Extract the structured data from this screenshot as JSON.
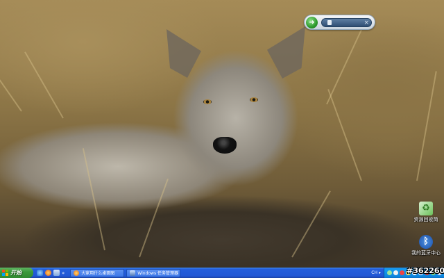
{
  "desktop": {
    "wallpaper": "wolf-in-grass",
    "icons": [
      {
        "label": "资源回收筒",
        "icon": "recycle-bin-icon"
      },
      {
        "label": "我的蓝牙中心",
        "icon": "bluetooth-icon"
      }
    ]
  },
  "gadget": {
    "go_icon": "go-arrow-icon",
    "field_icon": "lock-icon",
    "clear_symbol": "×"
  },
  "taskbar": {
    "start_label": "开始",
    "quick_launch": [
      "ie-icon",
      "firefox-icon",
      "show-desktop-icon"
    ],
    "quick_launch_expand": "»",
    "tasks": [
      {
        "label": "大家用什么桌面图",
        "icon": "browser-icon"
      },
      {
        "label": "Windows 任务管理器",
        "icon": "task-manager-icon"
      }
    ],
    "language": "CH",
    "tray_icons": [
      "network-icon",
      "volume-icon",
      "antivirus-icon",
      "qq-icon",
      "update-icon",
      "bluetooth-tray-icon",
      "shield-icon",
      "safely-remove-icon",
      "ime-icon"
    ],
    "clock": "12:03"
  },
  "watermark": "#362260",
  "colors": {
    "taskbar_blue": "#245edb",
    "start_green": "#3c9a3c",
    "tray_blue": "#0f86de"
  }
}
